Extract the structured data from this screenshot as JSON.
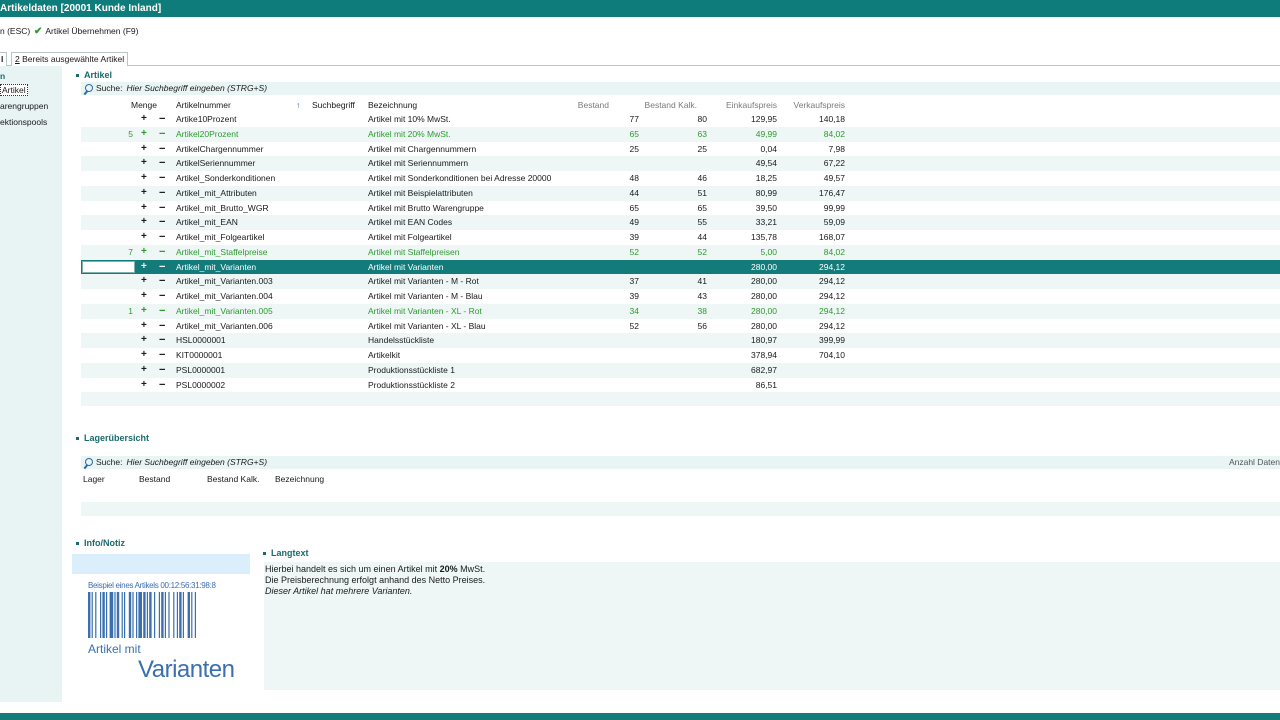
{
  "window": {
    "title": "Artikeldaten [20001 Kunde Inland]"
  },
  "toolbar": {
    "cancel_label": "n (ESC)",
    "accept_label": "Artikel Übernehmen (F9)"
  },
  "tabs": [
    {
      "label": "l"
    },
    {
      "label": "2 Bereits ausgewählte Artikel"
    }
  ],
  "nav": {
    "items": [
      {
        "label": "n"
      },
      {
        "label": "Artikel"
      },
      {
        "label": "arengruppen"
      },
      {
        "label": "ektionspools"
      }
    ]
  },
  "artikel": {
    "title": "Artikel",
    "search": {
      "label": "Suche:",
      "placeholder": "Hier Suchbegriff eingeben (STRG+S)"
    },
    "columns": {
      "menge": "Menge",
      "artikelnummer": "Artikelnummer",
      "sort_indicator": "↑",
      "suchbegriff": "Suchbegriff",
      "bezeichnung": "Bezeichnung",
      "bestand": "Bestand",
      "bestand_kalk": "Bestand Kalk.",
      "einkaufspreis": "Einkaufspreis",
      "verkaufspreis": "Verkaufspreis"
    },
    "rows": [
      {
        "menge": "",
        "nr": "Artike10Prozent",
        "bez": "Artikel mit 10% MwSt.",
        "bestand": "77",
        "kalk": "80",
        "ek": "129,95",
        "vk": "140,18",
        "style": ""
      },
      {
        "menge": "5",
        "nr": "Artikel20Prozent",
        "bez": "Artikel mit 20% MwSt.",
        "bestand": "65",
        "kalk": "63",
        "ek": "49,99",
        "vk": "84,02",
        "style": "green"
      },
      {
        "menge": "",
        "nr": "ArtikelChargennummer",
        "bez": "Artikel mit Chargennummern",
        "bestand": "25",
        "kalk": "25",
        "ek": "0,04",
        "vk": "7,98",
        "style": ""
      },
      {
        "menge": "",
        "nr": "ArtikelSeriennummer",
        "bez": "Artikel mit Seriennummern",
        "bestand": "",
        "kalk": "",
        "ek": "49,54",
        "vk": "67,22",
        "style": ""
      },
      {
        "menge": "",
        "nr": "Artikel_Sonderkonditionen",
        "bez": "Artikel mit Sonderkonditionen bei Adresse 20000",
        "bestand": "48",
        "kalk": "46",
        "ek": "18,25",
        "vk": "49,57",
        "style": ""
      },
      {
        "menge": "",
        "nr": "Artikel_mit_Attributen",
        "bez": "Artikel mit Beispielattributen",
        "bestand": "44",
        "kalk": "51",
        "ek": "80,99",
        "vk": "176,47",
        "style": ""
      },
      {
        "menge": "",
        "nr": "Artikel_mit_Brutto_WGR",
        "bez": "Artikel mit Brutto Warengruppe",
        "bestand": "65",
        "kalk": "65",
        "ek": "39,50",
        "vk": "99,99",
        "style": ""
      },
      {
        "menge": "",
        "nr": "Artikel_mit_EAN",
        "bez": "Artikel mit EAN Codes",
        "bestand": "49",
        "kalk": "55",
        "ek": "33,21",
        "vk": "59,09",
        "style": ""
      },
      {
        "menge": "",
        "nr": "Artikel_mit_Folgeartikel",
        "bez": "Artikel mit Folgeartikel",
        "bestand": "39",
        "kalk": "44",
        "ek": "135,78",
        "vk": "168,07",
        "style": ""
      },
      {
        "menge": "7",
        "nr": "Artikel_mit_Staffelpreise",
        "bez": "Artikel mit Staffelpreisen",
        "bestand": "52",
        "kalk": "52",
        "ek": "5,00",
        "vk": "84,02",
        "style": "green"
      },
      {
        "menge": "",
        "nr": "Artikel_mit_Varianten",
        "bez": "Artikel mit Varianten",
        "bestand": "",
        "kalk": "",
        "ek": "280,00",
        "vk": "294,12",
        "style": "sel"
      },
      {
        "menge": "",
        "nr": "Artikel_mit_Varianten.003",
        "bez": "Artikel mit Varianten - M - Rot",
        "bestand": "37",
        "kalk": "41",
        "ek": "280,00",
        "vk": "294,12",
        "style": ""
      },
      {
        "menge": "",
        "nr": "Artikel_mit_Varianten.004",
        "bez": "Artikel mit Varianten - M - Blau",
        "bestand": "39",
        "kalk": "43",
        "ek": "280,00",
        "vk": "294,12",
        "style": ""
      },
      {
        "menge": "1",
        "nr": "Artikel_mit_Varianten.005",
        "bez": "Artikel mit Varianten - XL - Rot",
        "bestand": "34",
        "kalk": "38",
        "ek": "280,00",
        "vk": "294,12",
        "style": "green"
      },
      {
        "menge": "",
        "nr": "Artikel_mit_Varianten.006",
        "bez": "Artikel mit Varianten - XL - Blau",
        "bestand": "52",
        "kalk": "56",
        "ek": "280,00",
        "vk": "294,12",
        "style": ""
      },
      {
        "menge": "",
        "nr": "HSL0000001",
        "bez": "Handelsstückliste",
        "bestand": "",
        "kalk": "",
        "ek": "180,97",
        "vk": "399,99",
        "style": ""
      },
      {
        "menge": "",
        "nr": "KIT0000001",
        "bez": "Artikelkit",
        "bestand": "",
        "kalk": "",
        "ek": "378,94",
        "vk": "704,10",
        "style": ""
      },
      {
        "menge": "",
        "nr": "PSL0000001",
        "bez": "Produktionsstückliste 1",
        "bestand": "",
        "kalk": "",
        "ek": "682,97",
        "vk": "",
        "style": ""
      },
      {
        "menge": "",
        "nr": "PSL0000002",
        "bez": "Produktionsstückliste 2",
        "bestand": "",
        "kalk": "",
        "ek": "86,51",
        "vk": "",
        "style": ""
      }
    ]
  },
  "lager": {
    "title": "Lagerübersicht",
    "search": {
      "label": "Suche:",
      "placeholder": "Hier Suchbegriff eingeben (STRG+S)"
    },
    "count_label": "Anzahl Daten",
    "columns": {
      "lager": "Lager",
      "bestand": "Bestand",
      "bestand_kalk": "Bestand Kalk.",
      "bezeichnung": "Bezeichnung"
    }
  },
  "info": {
    "title": "Info/Notiz",
    "barcode_caption": "Beispiel eines Artikels 00:12:56:31:98:8",
    "image_line1": "Artikel mit",
    "image_line2": "Varianten"
  },
  "langtext": {
    "title": "Langtext",
    "line1_pre": "Hierbei handelt es sich um einen Artikel mit ",
    "line1_bold": "20%",
    "line1_post": " MwSt.",
    "line2": "Die Preisberechnung erfolgt anhand des Netto Preises.",
    "line3": "Dieser Artikel hat mehrere Varianten."
  }
}
